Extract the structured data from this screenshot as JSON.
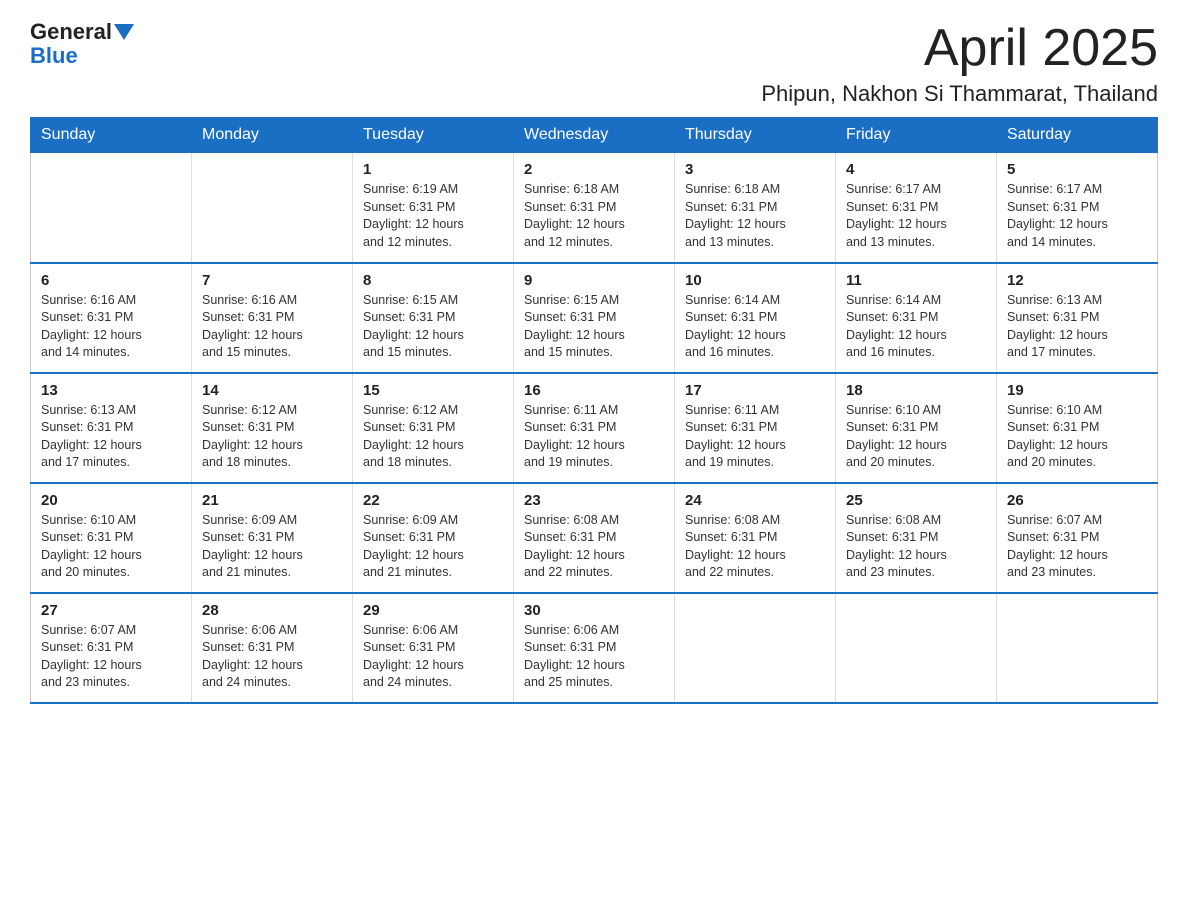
{
  "header": {
    "logo_general": "General",
    "logo_blue": "Blue",
    "month_title": "April 2025",
    "location": "Phipun, Nakhon Si Thammarat, Thailand"
  },
  "weekdays": [
    "Sunday",
    "Monday",
    "Tuesday",
    "Wednesday",
    "Thursday",
    "Friday",
    "Saturday"
  ],
  "weeks": [
    [
      {
        "day": "",
        "info": ""
      },
      {
        "day": "",
        "info": ""
      },
      {
        "day": "1",
        "info": "Sunrise: 6:19 AM\nSunset: 6:31 PM\nDaylight: 12 hours\nand 12 minutes."
      },
      {
        "day": "2",
        "info": "Sunrise: 6:18 AM\nSunset: 6:31 PM\nDaylight: 12 hours\nand 12 minutes."
      },
      {
        "day": "3",
        "info": "Sunrise: 6:18 AM\nSunset: 6:31 PM\nDaylight: 12 hours\nand 13 minutes."
      },
      {
        "day": "4",
        "info": "Sunrise: 6:17 AM\nSunset: 6:31 PM\nDaylight: 12 hours\nand 13 minutes."
      },
      {
        "day": "5",
        "info": "Sunrise: 6:17 AM\nSunset: 6:31 PM\nDaylight: 12 hours\nand 14 minutes."
      }
    ],
    [
      {
        "day": "6",
        "info": "Sunrise: 6:16 AM\nSunset: 6:31 PM\nDaylight: 12 hours\nand 14 minutes."
      },
      {
        "day": "7",
        "info": "Sunrise: 6:16 AM\nSunset: 6:31 PM\nDaylight: 12 hours\nand 15 minutes."
      },
      {
        "day": "8",
        "info": "Sunrise: 6:15 AM\nSunset: 6:31 PM\nDaylight: 12 hours\nand 15 minutes."
      },
      {
        "day": "9",
        "info": "Sunrise: 6:15 AM\nSunset: 6:31 PM\nDaylight: 12 hours\nand 15 minutes."
      },
      {
        "day": "10",
        "info": "Sunrise: 6:14 AM\nSunset: 6:31 PM\nDaylight: 12 hours\nand 16 minutes."
      },
      {
        "day": "11",
        "info": "Sunrise: 6:14 AM\nSunset: 6:31 PM\nDaylight: 12 hours\nand 16 minutes."
      },
      {
        "day": "12",
        "info": "Sunrise: 6:13 AM\nSunset: 6:31 PM\nDaylight: 12 hours\nand 17 minutes."
      }
    ],
    [
      {
        "day": "13",
        "info": "Sunrise: 6:13 AM\nSunset: 6:31 PM\nDaylight: 12 hours\nand 17 minutes."
      },
      {
        "day": "14",
        "info": "Sunrise: 6:12 AM\nSunset: 6:31 PM\nDaylight: 12 hours\nand 18 minutes."
      },
      {
        "day": "15",
        "info": "Sunrise: 6:12 AM\nSunset: 6:31 PM\nDaylight: 12 hours\nand 18 minutes."
      },
      {
        "day": "16",
        "info": "Sunrise: 6:11 AM\nSunset: 6:31 PM\nDaylight: 12 hours\nand 19 minutes."
      },
      {
        "day": "17",
        "info": "Sunrise: 6:11 AM\nSunset: 6:31 PM\nDaylight: 12 hours\nand 19 minutes."
      },
      {
        "day": "18",
        "info": "Sunrise: 6:10 AM\nSunset: 6:31 PM\nDaylight: 12 hours\nand 20 minutes."
      },
      {
        "day": "19",
        "info": "Sunrise: 6:10 AM\nSunset: 6:31 PM\nDaylight: 12 hours\nand 20 minutes."
      }
    ],
    [
      {
        "day": "20",
        "info": "Sunrise: 6:10 AM\nSunset: 6:31 PM\nDaylight: 12 hours\nand 20 minutes."
      },
      {
        "day": "21",
        "info": "Sunrise: 6:09 AM\nSunset: 6:31 PM\nDaylight: 12 hours\nand 21 minutes."
      },
      {
        "day": "22",
        "info": "Sunrise: 6:09 AM\nSunset: 6:31 PM\nDaylight: 12 hours\nand 21 minutes."
      },
      {
        "day": "23",
        "info": "Sunrise: 6:08 AM\nSunset: 6:31 PM\nDaylight: 12 hours\nand 22 minutes."
      },
      {
        "day": "24",
        "info": "Sunrise: 6:08 AM\nSunset: 6:31 PM\nDaylight: 12 hours\nand 22 minutes."
      },
      {
        "day": "25",
        "info": "Sunrise: 6:08 AM\nSunset: 6:31 PM\nDaylight: 12 hours\nand 23 minutes."
      },
      {
        "day": "26",
        "info": "Sunrise: 6:07 AM\nSunset: 6:31 PM\nDaylight: 12 hours\nand 23 minutes."
      }
    ],
    [
      {
        "day": "27",
        "info": "Sunrise: 6:07 AM\nSunset: 6:31 PM\nDaylight: 12 hours\nand 23 minutes."
      },
      {
        "day": "28",
        "info": "Sunrise: 6:06 AM\nSunset: 6:31 PM\nDaylight: 12 hours\nand 24 minutes."
      },
      {
        "day": "29",
        "info": "Sunrise: 6:06 AM\nSunset: 6:31 PM\nDaylight: 12 hours\nand 24 minutes."
      },
      {
        "day": "30",
        "info": "Sunrise: 6:06 AM\nSunset: 6:31 PM\nDaylight: 12 hours\nand 25 minutes."
      },
      {
        "day": "",
        "info": ""
      },
      {
        "day": "",
        "info": ""
      },
      {
        "day": "",
        "info": ""
      }
    ]
  ]
}
